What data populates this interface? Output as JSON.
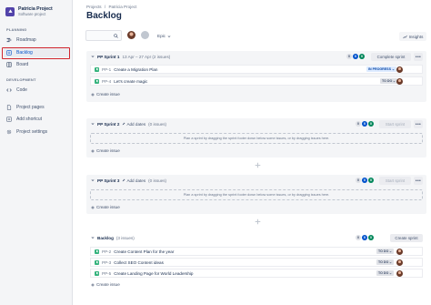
{
  "sidebar": {
    "project_name": "Patricia Project",
    "project_type": "Software project",
    "planning_label": "PLANNING",
    "development_label": "DEVELOPMENT",
    "items": [
      {
        "label": "Roadmap"
      },
      {
        "label": "Backlog"
      },
      {
        "label": "Board"
      },
      {
        "label": "Code"
      },
      {
        "label": "Project pages"
      },
      {
        "label": "Add shortcut"
      },
      {
        "label": "Project settings"
      }
    ]
  },
  "header": {
    "breadcrumb": [
      "Projects",
      "Patricia Project"
    ],
    "breadcrumb_sep": "/",
    "title": "Backlog"
  },
  "toolbar": {
    "search_placeholder": "",
    "epic_label": "Epic",
    "insights_label": "Insights"
  },
  "sprints": [
    {
      "name": "PP Sprint 1",
      "meta": "13 Apr – 27 Apr  (2 issues)",
      "counts": [
        "0",
        "0",
        "0"
      ],
      "button": "Complete sprint",
      "issues": [
        {
          "key": "PP-1",
          "summary": "Create a Migration Plan",
          "status": "IN PROGRESS"
        },
        {
          "key": "PP-4",
          "summary": "Let's create magic",
          "status": "TO DO"
        }
      ],
      "create": "Create issue"
    },
    {
      "name": "PP Sprint 2",
      "add_dates": "Add dates",
      "meta": "(0 issues)",
      "counts": [
        "0",
        "0",
        "0"
      ],
      "button": "Start sprint",
      "empty_text": "Plan a sprint by dragging the sprint footer down below some issues, or by dragging issues here.",
      "create": "Create issue"
    },
    {
      "name": "PP Sprint 3",
      "add_dates": "Add dates",
      "meta": "(0 issues)",
      "counts": [
        "0",
        "0",
        "0"
      ],
      "button": "Start sprint",
      "empty_text": "Plan a sprint by dragging the sprint footer down below some issues, or by dragging issues here.",
      "create": "Create issue"
    }
  ],
  "backlog": {
    "name": "Backlog",
    "meta": "(3 issues)",
    "counts": [
      "0",
      "0",
      "0"
    ],
    "button": "Create sprint",
    "issues": [
      {
        "key": "PP-2",
        "summary": "Create Content Plan for the year",
        "status": "TO DO"
      },
      {
        "key": "PP-3",
        "summary": "Collect SEO Content ideas",
        "status": "TO DO"
      },
      {
        "key": "PP-5",
        "summary": "Create Landing Page for World Leadership",
        "status": "TO DO"
      }
    ],
    "create": "Create issue"
  },
  "colors": {
    "accent": "#0052cc",
    "highlight": "#d0252e",
    "story": "#36b37e",
    "in_progress_bg": "#deebff"
  }
}
